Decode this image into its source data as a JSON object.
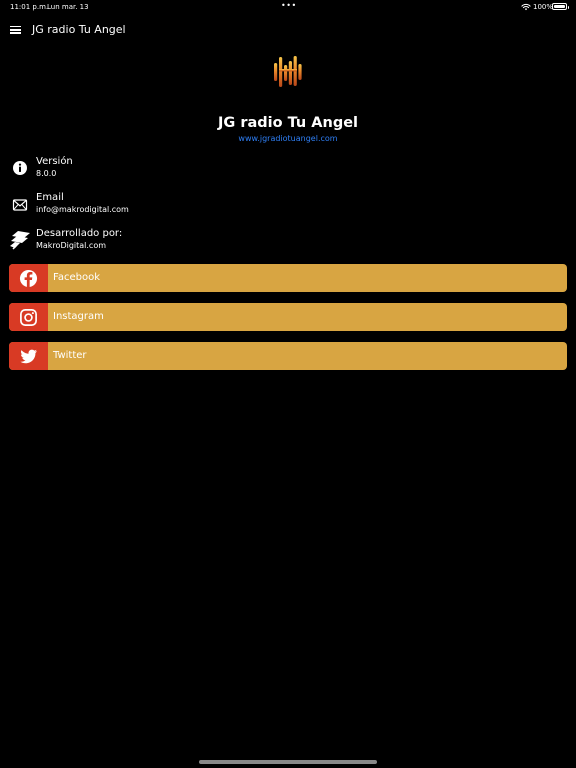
{
  "status": {
    "time": "11:01 p.m.",
    "date": "Lun mar. 13",
    "dots": "•••",
    "battery_text": "100%"
  },
  "nav": {
    "title": "JG radio Tu Angel"
  },
  "app": {
    "title": "JG radio Tu Angel",
    "link": "www.jgradiotuangel.com"
  },
  "info": [
    {
      "label": "Versión",
      "value": "8.0.0",
      "icon": "info-icon"
    },
    {
      "label": "Email",
      "value": "info@makrodigital.com",
      "icon": "envelope-icon"
    },
    {
      "label": "Desarrollado por:",
      "value": "MakroDigital.com",
      "icon": "makro-logo-icon"
    }
  ],
  "social": [
    {
      "label": "Facebook",
      "icon": "facebook-icon"
    },
    {
      "label": "Instagram",
      "icon": "instagram-icon"
    },
    {
      "label": "Twitter",
      "icon": "twitter-icon"
    }
  ],
  "colors": {
    "background": "#000000",
    "button": "#d8a542",
    "icon_box": "#d83a24",
    "link": "#2f7ff5"
  }
}
